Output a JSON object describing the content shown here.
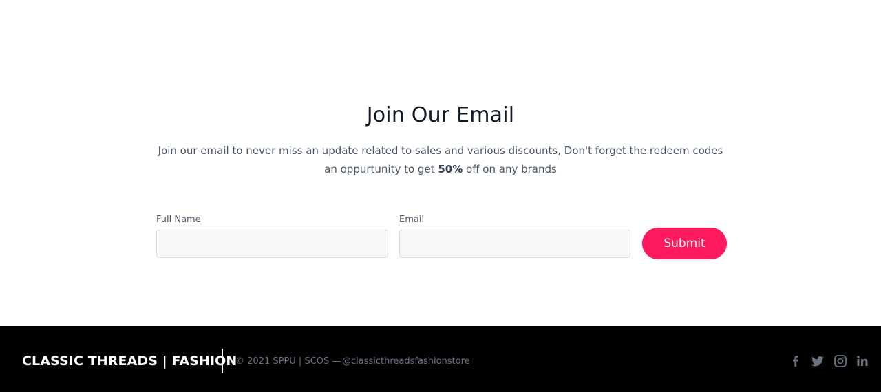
{
  "signup": {
    "title": "Join Our Email",
    "description_part1": "Join our email to never miss an update related to sales and various discounts, Don't forget the redeem codes an oppurtunity to get ",
    "description_bold": "50%",
    "description_part2": " off on any brands",
    "fields": {
      "full_name_label": "Full Name",
      "full_name_value": "",
      "email_label": "Email",
      "email_value": ""
    },
    "submit_label": "Submit",
    "accent_color": "#ff1a5e"
  },
  "footer": {
    "brand": "CLASSIC THREADS | FASHION",
    "copyright": "© 2021 SPPU | SCOS —",
    "handle": "@classicthreadsfashionstore",
    "social_icons": [
      "facebook-icon",
      "twitter-icon",
      "instagram-icon",
      "linkedin-icon"
    ],
    "background_color": "#000000",
    "icon_color": "#6b7280"
  }
}
